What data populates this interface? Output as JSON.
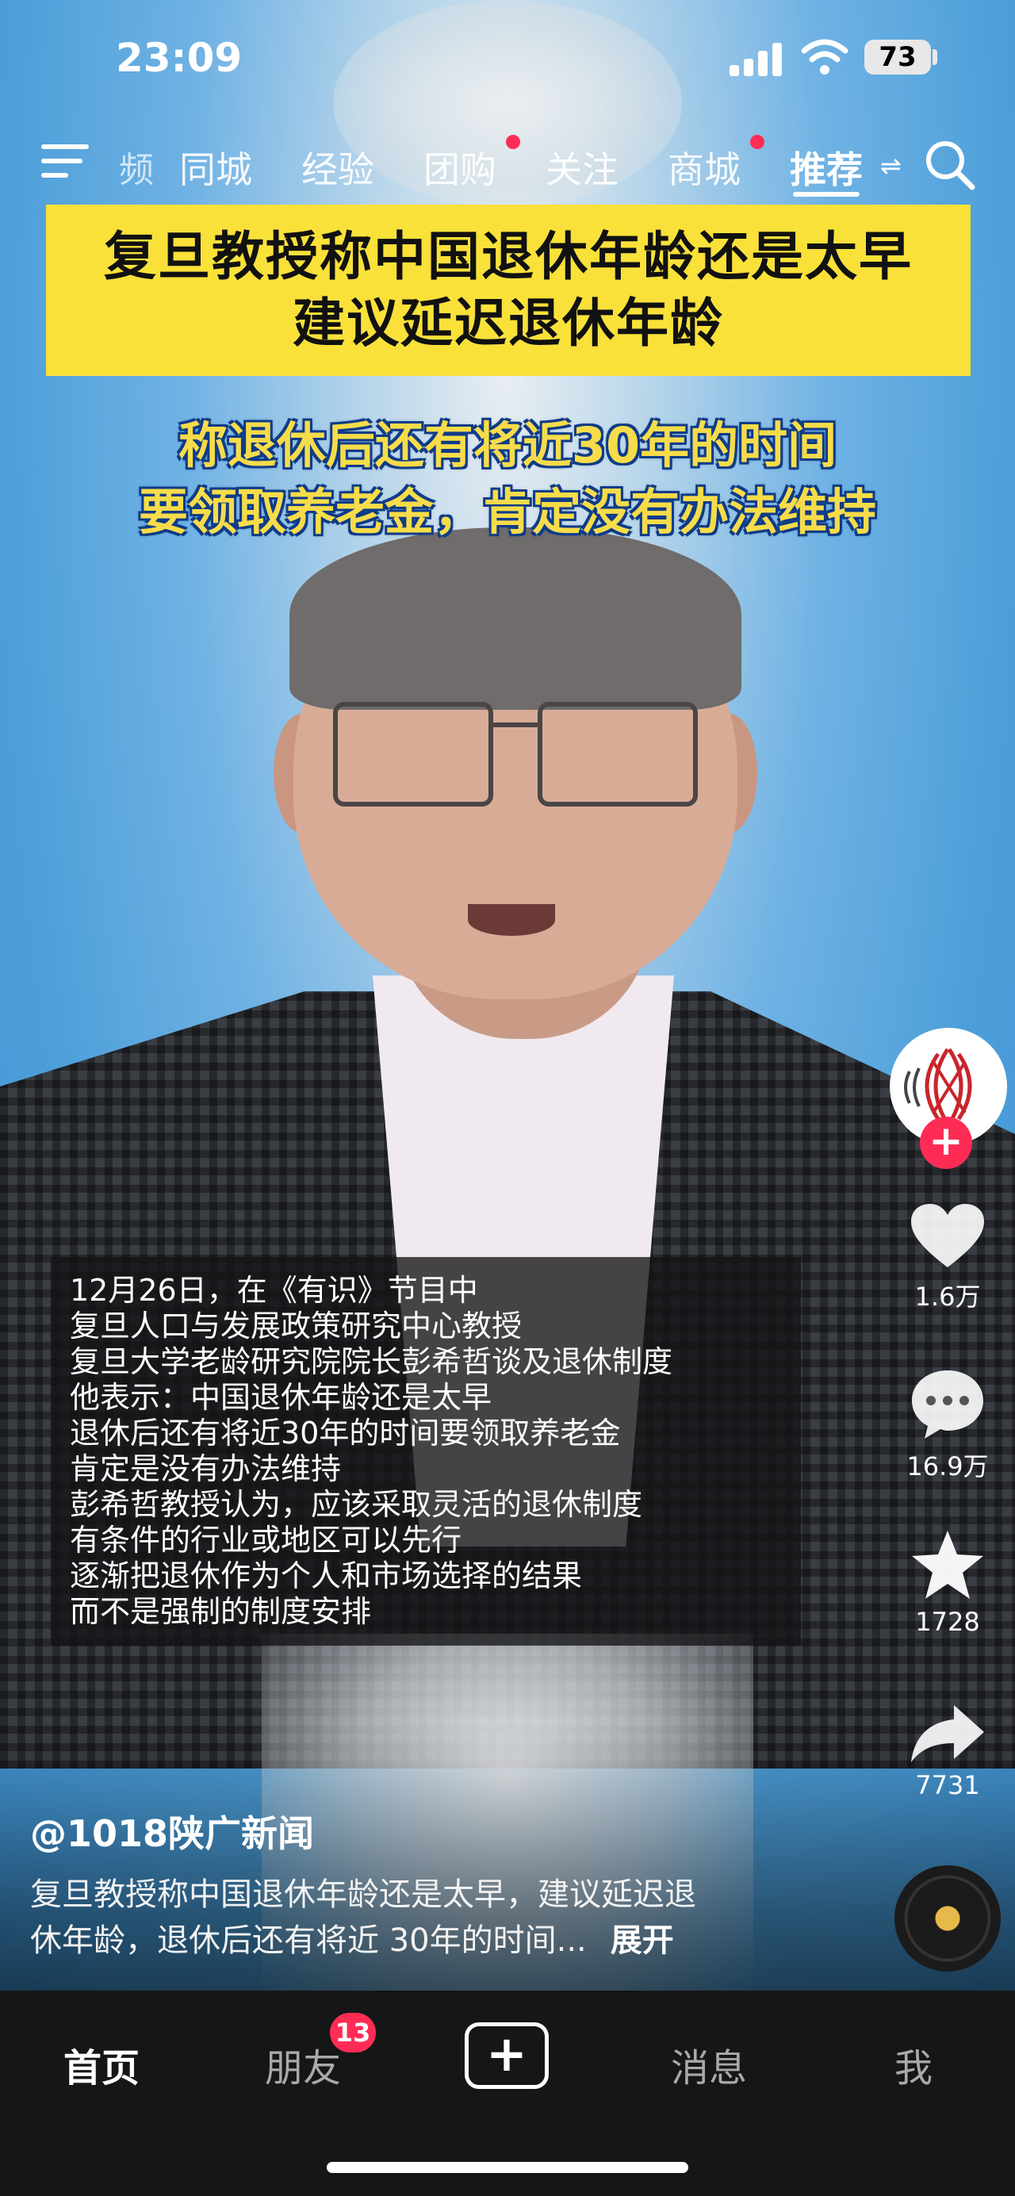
{
  "status_bar": {
    "time": "23:09",
    "battery": "73",
    "icons": [
      "signal-icon",
      "wifi-icon",
      "battery-icon"
    ]
  },
  "top_nav": {
    "fragment_tab": "频",
    "tabs": [
      {
        "label": "同城",
        "dot": false
      },
      {
        "label": "经验",
        "dot": false
      },
      {
        "label": "团购",
        "dot": true
      },
      {
        "label": "关注",
        "dot": false
      },
      {
        "label": "商城",
        "dot": true
      },
      {
        "label": "推荐",
        "dot": false,
        "active": true
      }
    ],
    "icons": [
      "menu-icon",
      "swap-icon",
      "search-icon"
    ]
  },
  "video": {
    "title_lines": [
      "复旦教授称中国退休年龄还是太早",
      "建议延迟退休年龄"
    ],
    "subtitle_lines": [
      "称退休后还有将近30年的时间",
      "要领取养老金，肯定没有办法维持"
    ],
    "caption_lines": [
      "12月26日，在《有识》节目中",
      "复旦人口与发展政策研究中心教授",
      "复旦大学老龄研究院院长彭希哲谈及退休制度",
      "他表示：中国退休年龄还是太早",
      "退休后还有将近30年的时间要领取养老金",
      "肯定是没有办法维持",
      "彭希哲教授认为，应该采取灵活的退休制度",
      "有条件的行业或地区可以先行",
      "逐渐把退休作为个人和市场选择的结果",
      "而不是强制的制度安排"
    ]
  },
  "actions": {
    "follow": "+",
    "likes": "1.6万",
    "comments": "16.9万",
    "favorites": "1728",
    "shares": "7731",
    "colors": {
      "follow": "#fe2c55",
      "music_disc_center": "#e7b94a"
    }
  },
  "post": {
    "author": "@1018陕广新闻",
    "description_line1": "复旦教授称中国退休年龄还是太早，建议延迟退",
    "description_line2": "休年龄，退休后还有将近 30年的时间...",
    "expand": "展开"
  },
  "tab_bar": {
    "home": "首页",
    "friends": "朋友",
    "friends_badge": "13",
    "add": "+",
    "messages": "消息",
    "me": "我"
  }
}
